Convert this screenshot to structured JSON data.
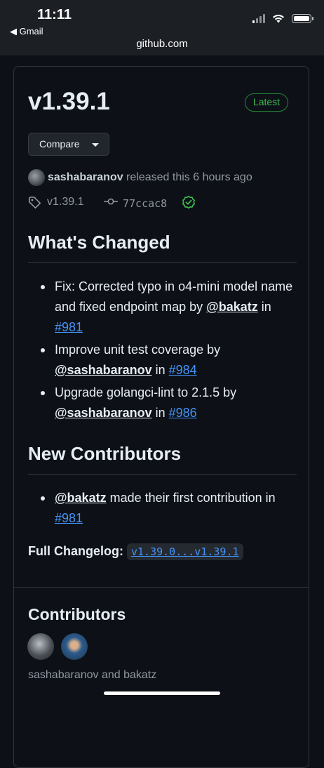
{
  "status_bar": {
    "time": "11:11",
    "back_app": "◀ Gmail"
  },
  "browser": {
    "url": "github.com"
  },
  "release": {
    "version": "v1.39.1",
    "badge": "Latest",
    "compare_label": "Compare",
    "author": "sashabaranov",
    "released_text": " released this 6 hours ago",
    "tag": "v1.39.1",
    "commit": "77ccac8"
  },
  "whats_changed": {
    "heading": "What's Changed",
    "items": [
      {
        "text": "Fix: Corrected typo in o4-mini model name and fixed endpoint map by ",
        "user": "@bakatz",
        "in": " in ",
        "pr": "#981"
      },
      {
        "text": "Improve unit test coverage by ",
        "user": "@sashabaranov",
        "in": " in ",
        "pr": "#984"
      },
      {
        "text": "Upgrade golangci-lint to 2.1.5 by ",
        "user": "@sashabaranov",
        "in": " in ",
        "pr": "#986"
      }
    ]
  },
  "new_contributors": {
    "heading": "New Contributors",
    "items": [
      {
        "user": "@bakatz",
        "text": " made their first contribution in ",
        "pr": "#981"
      }
    ]
  },
  "full_changelog": {
    "label": "Full Changelog",
    "colon": ": ",
    "range": "v1.39.0...v1.39.1"
  },
  "contributors": {
    "heading": "Contributors",
    "names": "sashabaranov and bakatz"
  },
  "colors": {
    "accent": "#4493f8",
    "latest": "#3fb950",
    "background": "#0d1117"
  }
}
